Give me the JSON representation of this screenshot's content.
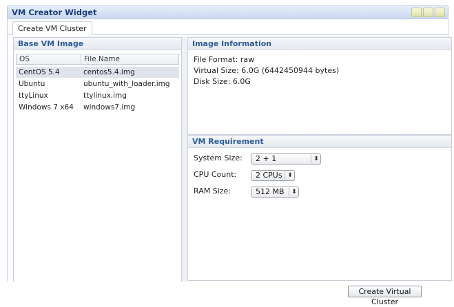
{
  "window": {
    "title": "VM Creator Widget"
  },
  "tabs": [
    {
      "label": "Create VM Cluster"
    }
  ],
  "base_image": {
    "title": "Base VM Image",
    "columns": [
      "OS",
      "File Name"
    ],
    "rows": [
      {
        "os": "CentOS 5.4",
        "file": "centos5.4.img"
      },
      {
        "os": "Ubuntu",
        "file": "ubuntu_with_loader.img"
      },
      {
        "os": "ttyLinux",
        "file": "ttylinux.img"
      },
      {
        "os": "Windows 7 x64",
        "file": "windows7.img"
      }
    ]
  },
  "image_info": {
    "title": "Image Information",
    "file_format": "File Format: raw",
    "virtual_size": "Virtual Size: 6.0G (6442450944 bytes)",
    "disk_size": "Disk Size: 6.0G"
  },
  "vm_requirement": {
    "title": "VM Requirement",
    "system_size_label": "System Size:",
    "system_size_value": "2 + 1",
    "cpu_count_label": "CPU Count:",
    "cpu_count_value": "2 CPUs",
    "ram_size_label": "RAM Size:",
    "ram_size_value": "512 MB"
  },
  "actions": {
    "create_label": "Create Virtual Cluster"
  },
  "icons": {
    "select_arrows": "⬍"
  }
}
